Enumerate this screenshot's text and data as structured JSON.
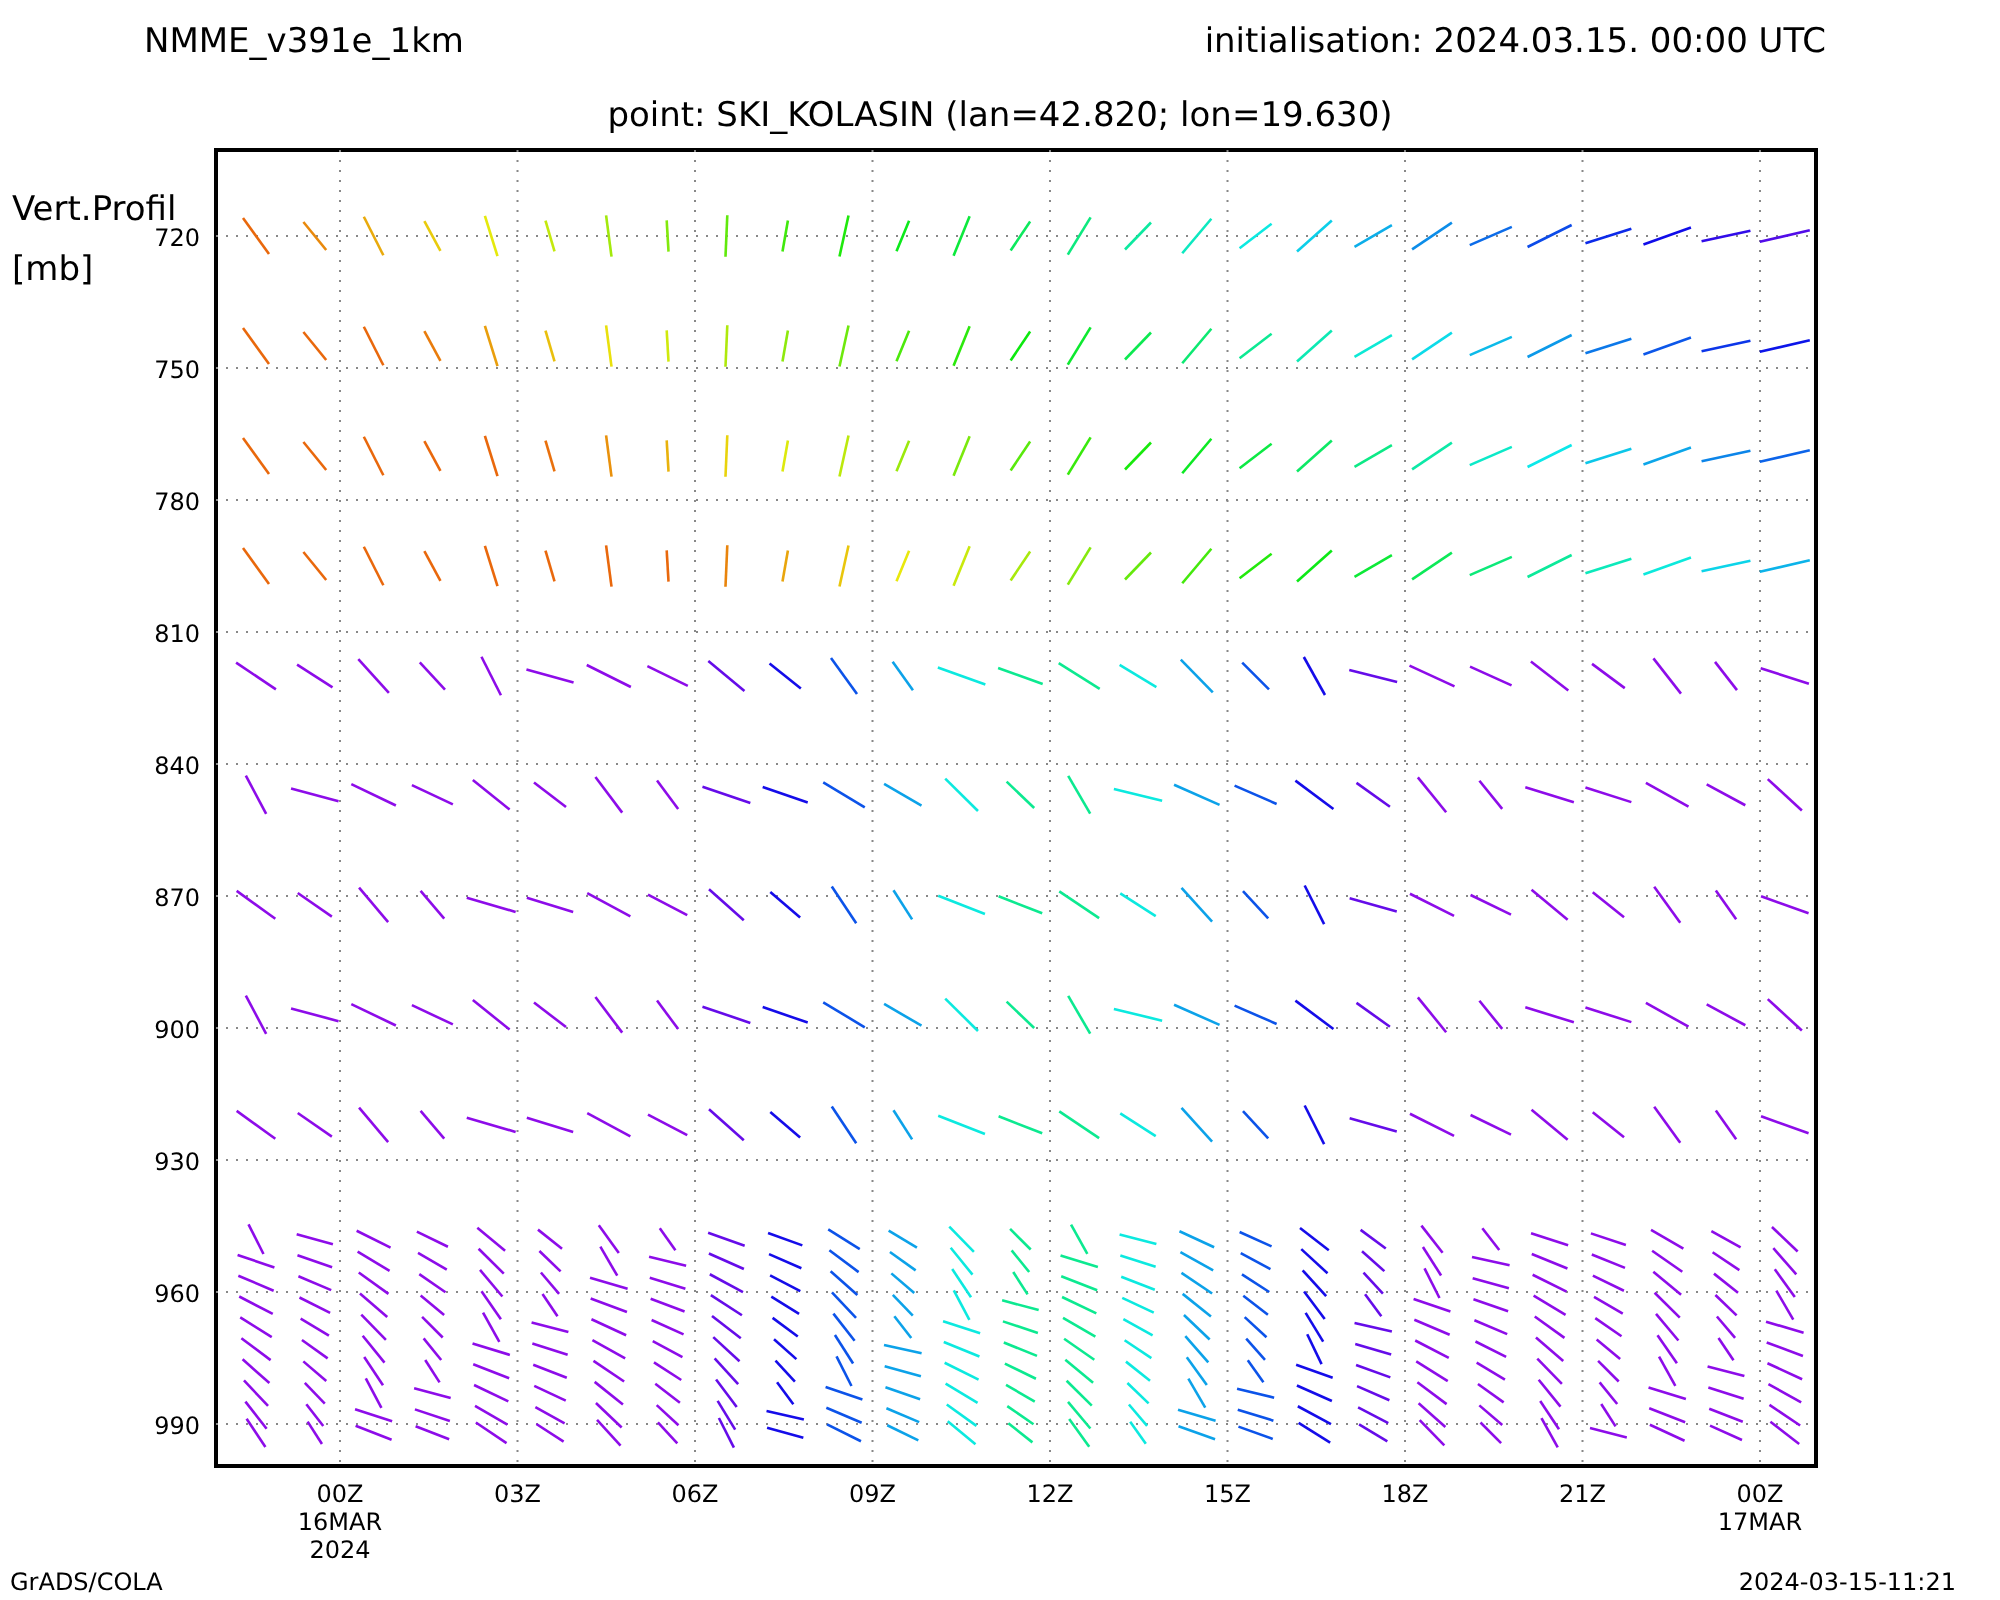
{
  "header": {
    "model": "NMME_v391e_1km",
    "initialisation": "initialisation: 2024.03.15. 00:00 UTC",
    "point": "point: SKI_KOLASIN (lan=42.820; lon=19.630)"
  },
  "y_axis": {
    "label": "Vert.Profil",
    "unit": "[mb]",
    "ticks": [
      "720",
      "750",
      "780",
      "810",
      "840",
      "870",
      "900",
      "930",
      "960",
      "990"
    ]
  },
  "x_axis": {
    "ticks": [
      {
        "label": "00Z",
        "sublabels": [
          "16MAR",
          "2024"
        ]
      },
      {
        "label": "03Z"
      },
      {
        "label": "06Z"
      },
      {
        "label": "09Z"
      },
      {
        "label": "12Z"
      },
      {
        "label": "15Z"
      },
      {
        "label": "18Z"
      },
      {
        "label": "21Z"
      },
      {
        "label": "00Z",
        "sublabels": [
          "17MAR"
        ]
      }
    ]
  },
  "footer": {
    "left": "GrADS/COLA",
    "right": "2024-03-15-11:21"
  }
}
